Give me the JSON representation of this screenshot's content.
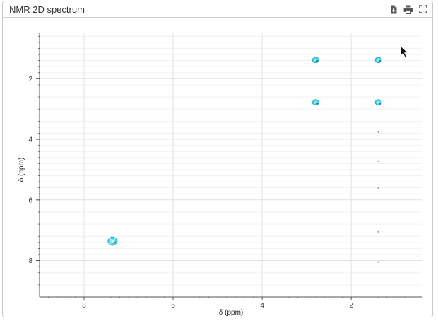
{
  "panel": {
    "title": "NMR 2D spectrum",
    "tools": [
      {
        "name": "export-icon"
      },
      {
        "name": "print-icon"
      },
      {
        "name": "fullscreen-icon"
      }
    ]
  },
  "colors": {
    "peak_main": "#3fd6e6",
    "peak_outline": "#2a9fb0",
    "peak_dark": "#444444",
    "small_red": "#e03a3a",
    "small_gray": "#9a9a9a",
    "grid": "#e3e3e3",
    "axis": "#555555"
  },
  "chart_data": {
    "type": "scatter",
    "title": "",
    "xlabel": "δ (ppm)",
    "ylabel": "δ (ppm)",
    "xlim": [
      9,
      0.4
    ],
    "ylim": [
      0.5,
      9.2
    ],
    "x_reversed": true,
    "y_reversed": true,
    "grid": true,
    "x_ticks": [
      8,
      6,
      4,
      2
    ],
    "y_ticks": [
      2,
      4,
      6,
      8
    ],
    "x_tick_labels": [
      "8",
      "6",
      "4",
      "2"
    ],
    "y_tick_labels": [
      "2",
      "4",
      "6",
      "8"
    ],
    "peaks": [
      {
        "x": 7.36,
        "y": 7.36,
        "size": "large"
      },
      {
        "x": 2.8,
        "y": 1.38,
        "size": "medium"
      },
      {
        "x": 1.39,
        "y": 1.38,
        "size": "medium"
      },
      {
        "x": 2.8,
        "y": 2.78,
        "size": "medium"
      },
      {
        "x": 1.39,
        "y": 2.78,
        "size": "medium"
      },
      {
        "x": 1.39,
        "y": 3.75,
        "size": "dot",
        "color": "red"
      },
      {
        "x": 1.39,
        "y": 4.72,
        "size": "dot",
        "color": "gray"
      },
      {
        "x": 1.39,
        "y": 5.6,
        "size": "dot",
        "color": "gray"
      },
      {
        "x": 1.39,
        "y": 7.05,
        "size": "dot",
        "color": "gray"
      },
      {
        "x": 1.39,
        "y": 8.05,
        "size": "dot",
        "color": "gray"
      }
    ]
  }
}
